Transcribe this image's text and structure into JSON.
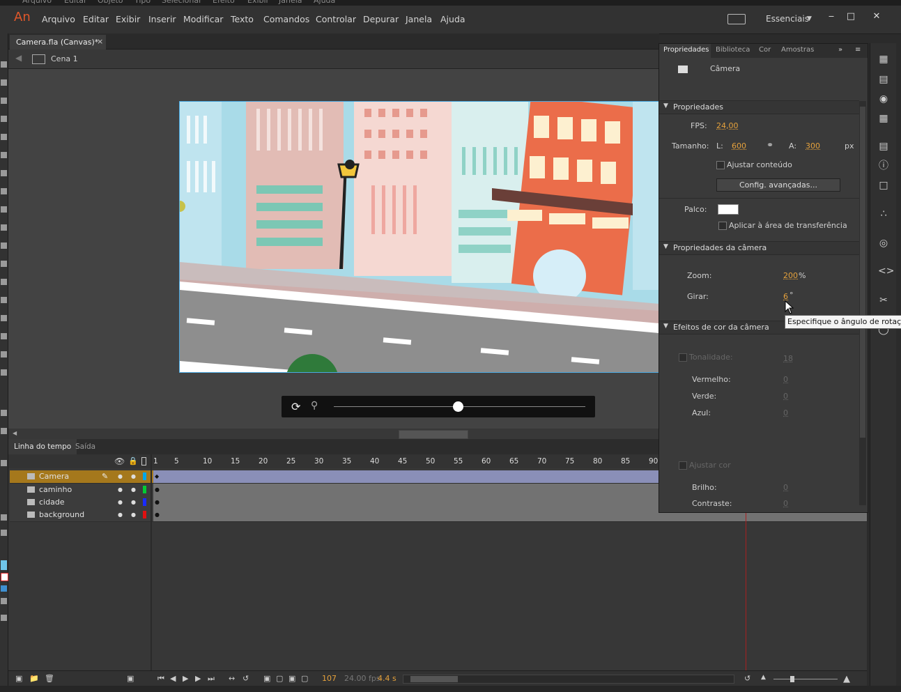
{
  "app": {
    "logo": "An"
  },
  "residual_menu": [
    "Arquivo",
    "Editar",
    "Objeto",
    "Tipo",
    "Selecionar",
    "Efeito",
    "Exibir",
    "Janela",
    "Ajuda"
  ],
  "menu": [
    "Arquivo",
    "Editar",
    "Exibir",
    "Inserir",
    "Modificar",
    "Texto",
    "Comandos",
    "Controlar",
    "Depurar",
    "Janela",
    "Ajuda"
  ],
  "workspace": {
    "label": "Essenciais"
  },
  "window_controls": {
    "minimize": "‒",
    "restore": "□",
    "close": "✕"
  },
  "document_tab": {
    "label": "Camera.fla (Canvas)*",
    "close": "×"
  },
  "scene": {
    "label": "Cena 1"
  },
  "timeline_tabs": [
    {
      "label": "Linha do tempo"
    },
    {
      "label": "Saída"
    }
  ],
  "frame_numbers": [
    "1",
    "5",
    "10",
    "15",
    "20",
    "25",
    "30",
    "35",
    "40",
    "45",
    "50",
    "55",
    "60",
    "65",
    "70",
    "75",
    "80",
    "85",
    "90"
  ],
  "layers": [
    {
      "name": "Camera",
      "color": "#00a8e8",
      "active": true
    },
    {
      "name": "caminho",
      "color": "#00cc33",
      "active": false
    },
    {
      "name": "cidade",
      "color": "#1a2bff",
      "active": false
    },
    {
      "name": "background",
      "color": "#e01010",
      "active": false
    }
  ],
  "timeline_footer": {
    "current_frame": "107",
    "fps": "24.00 fps",
    "time": "4.4 s"
  },
  "properties": {
    "tabs": [
      "Propriedades",
      "Biblioteca",
      "Cor",
      "Amostras"
    ],
    "object_label": "Câmera",
    "sections": {
      "props": "Propriedades",
      "camera_props": "Propriedades da câmera",
      "color_effects": "Efeitos de cor da câmera"
    },
    "fps_label": "FPS:",
    "fps_value": "24,00",
    "size_label": "Tamanho:",
    "width_label": "L:",
    "width_value": "600",
    "height_label": "A:",
    "height_value": "300",
    "size_unit": "px",
    "adjust_content": "Ajustar conteúdo",
    "advanced_button": "Config. avançadas...",
    "stage_label": "Palco:",
    "stage_color": "#ffffff",
    "clip_label": "Aplicar à área de transferência",
    "zoom_label": "Zoom:",
    "zoom_value": "200",
    "zoom_unit": "%",
    "rotate_label": "Girar:",
    "rotate_value": "6",
    "rotate_unit": "°",
    "tint_label": "Tonalidade:",
    "tint_value": "18",
    "red_label": "Vermelho:",
    "red_value": "0",
    "green_label": "Verde:",
    "green_value": "0",
    "blue_label": "Azul:",
    "blue_value": "0",
    "adjust_color": "Ajustar cor",
    "brightness_label": "Brilho:",
    "brightness_value": "0",
    "contrast_label": "Contraste:",
    "contrast_value": "0"
  },
  "tooltip": "Especifique o ângulo de rotação"
}
